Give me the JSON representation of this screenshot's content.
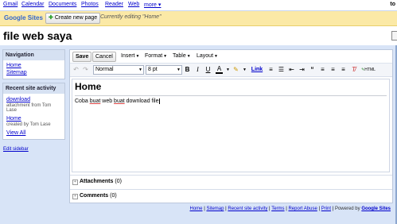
{
  "topnav": {
    "links": [
      "Gmail",
      "Calendar",
      "Documents",
      "Photos",
      "Reader",
      "Web",
      "more ▾"
    ],
    "user": "to"
  },
  "sitesbar": {
    "logo": "Google Sites",
    "create_label": "Create new page",
    "editing_text": "Currently editing \"Home\""
  },
  "site": {
    "title": "file web saya"
  },
  "sidebar": {
    "navigation_header": "Navigation",
    "nav_items": [
      "Home",
      "Sitemap"
    ],
    "activity_header": "Recent site activity",
    "activity": [
      {
        "link": "download",
        "detail": "attachment from Tom Lase"
      },
      {
        "link": "Home",
        "detail": "created by Tom Lase"
      }
    ],
    "view_all": "View All",
    "edit_sidebar": "Edit sidebar"
  },
  "editor": {
    "save_label": "Save",
    "cancel_label": "Cancel",
    "menus": [
      "Insert",
      "Format",
      "Table",
      "Layout"
    ],
    "style_select": "Normal",
    "size_select": "8 pt",
    "link_label": "Link",
    "html_label": "HTML",
    "page_title": "Home",
    "body": [
      "Coba ",
      "buat",
      " web ",
      "buat",
      " download file"
    ]
  },
  "sections": {
    "attachments": {
      "label": "Attachments",
      "count": "(0)"
    },
    "comments": {
      "label": "Comments",
      "count": "(0)"
    }
  },
  "footer": {
    "links": [
      "Home",
      "Sitemap",
      "Recent site activity",
      "Terms",
      "Report Abuse",
      "Print"
    ],
    "powered_prefix": "Powered by",
    "powered_brand": "Google Sites"
  }
}
